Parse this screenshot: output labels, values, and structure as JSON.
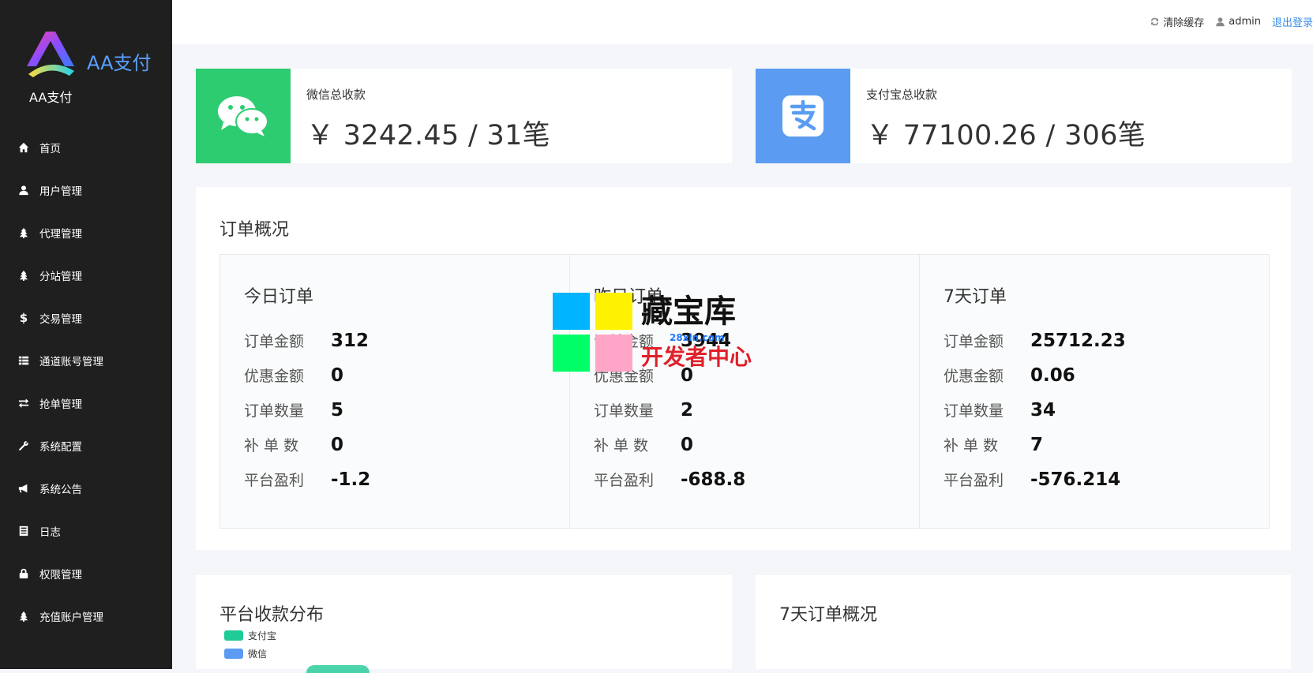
{
  "brand": {
    "name": "AA支付",
    "subtitle": "AA支付"
  },
  "sidebar": {
    "items": [
      {
        "label": "首页",
        "icon": "home-icon"
      },
      {
        "label": "用户管理",
        "icon": "user-icon"
      },
      {
        "label": "代理管理",
        "icon": "tree-icon"
      },
      {
        "label": "分站管理",
        "icon": "tree-icon"
      },
      {
        "label": "交易管理",
        "icon": "dollar-icon"
      },
      {
        "label": "通道账号管理",
        "icon": "list-icon"
      },
      {
        "label": "抢单管理",
        "icon": "swap-icon"
      },
      {
        "label": "系统配置",
        "icon": "wrench-icon"
      },
      {
        "label": "系统公告",
        "icon": "megaphone-icon"
      },
      {
        "label": "日志",
        "icon": "log-icon"
      },
      {
        "label": "权限管理",
        "icon": "lock-icon"
      },
      {
        "label": "充值账户管理",
        "icon": "tree-icon"
      }
    ]
  },
  "header": {
    "clear_cache": "清除缓存",
    "username": "admin",
    "logout": "退出登录"
  },
  "stats": {
    "wechat": {
      "label": "微信总收款",
      "value": "￥ 3242.45 / 31笔",
      "color": "#2ecc71"
    },
    "alipay": {
      "label": "支付宝总收款",
      "value": "￥ 77100.26 / 306笔",
      "color": "#5b9cf2"
    }
  },
  "overview": {
    "title": "订单概况",
    "row_labels": [
      "订单金额",
      "优惠金额",
      "订单数量",
      "补 单 数",
      "平台盈利"
    ],
    "columns": [
      {
        "title": "今日订单",
        "values": [
          "312",
          "0",
          "5",
          "0",
          "-1.2"
        ]
      },
      {
        "title": "昨日订单",
        "values": [
          "3944",
          "0",
          "2",
          "0",
          "-688.8"
        ]
      },
      {
        "title": "7天订单",
        "values": [
          "25712.23",
          "0.06",
          "34",
          "7",
          "-576.214"
        ]
      }
    ]
  },
  "distribution": {
    "title": "平台收款分布",
    "legend": [
      {
        "label": "支付宝",
        "color": "#1fcb96"
      },
      {
        "label": "微信",
        "color": "#5b9cf2"
      }
    ]
  },
  "weekly": {
    "title": "7天订单概况"
  },
  "watermark": {
    "line1": "藏宝库",
    "line2": "开发者中心",
    "line3": "28xin.com"
  }
}
